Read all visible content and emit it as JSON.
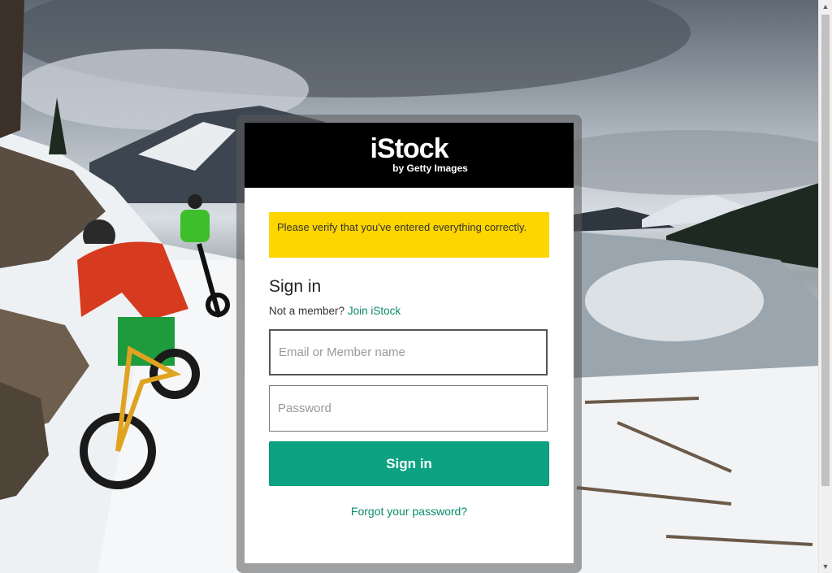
{
  "brand": {
    "logo_text": "iStock",
    "logo_subtext": "by Getty Images"
  },
  "alert": {
    "message": "Please verify that you've entered everything correctly."
  },
  "signin": {
    "title": "Sign in",
    "not_member_text": "Not a member?",
    "join_link": "Join iStock",
    "email_placeholder": "Email or Member name",
    "password_placeholder": "Password",
    "submit_label": "Sign in",
    "forgot_link": "Forgot your password?"
  },
  "colors": {
    "header_bg": "#000000",
    "alert_bg": "#fdd500",
    "primary_button": "#0ca282",
    "link": "#0b8a6a"
  }
}
